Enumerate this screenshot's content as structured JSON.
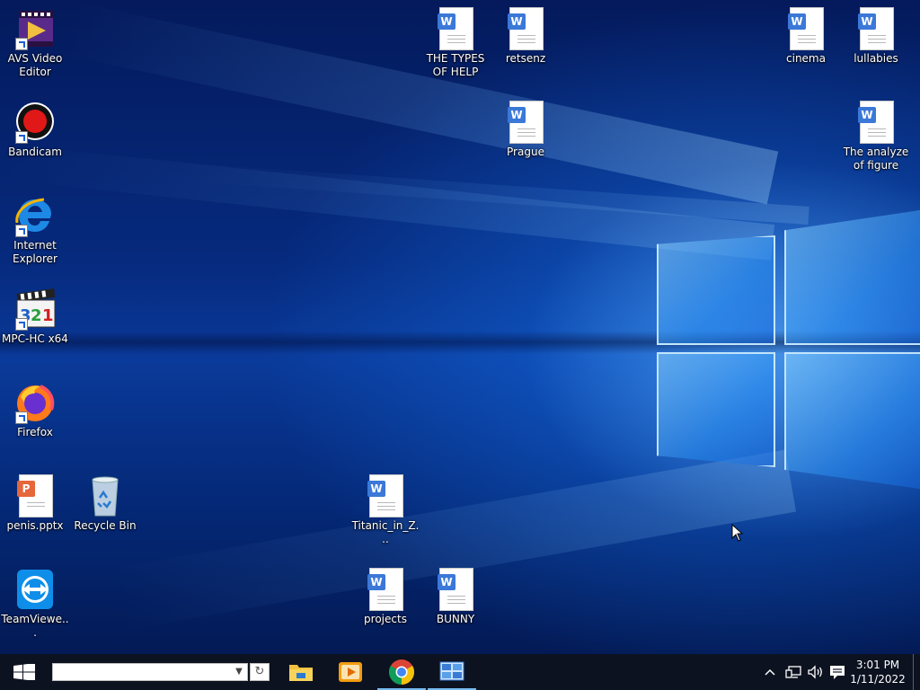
{
  "desktop": {
    "icons": [
      {
        "label": "AVS Video Editor",
        "icon": "avs-video-editor-icon",
        "shortcut": true
      },
      {
        "label": "Bandicam",
        "icon": "bandicam-icon",
        "shortcut": true
      },
      {
        "label": "Internet Explorer",
        "icon": "internet-explorer-icon",
        "shortcut": true
      },
      {
        "label": "MPC-HC x64",
        "icon": "mpc-hc-icon",
        "shortcut": true
      },
      {
        "label": "Firefox",
        "icon": "firefox-icon",
        "shortcut": true
      },
      {
        "label": "penis.pptx",
        "icon": "powerpoint-doc-icon",
        "shortcut": false
      },
      {
        "label": "Recycle Bin",
        "icon": "recycle-bin-icon",
        "shortcut": false
      },
      {
        "label": "TeamViewe...",
        "icon": "teamviewer-icon",
        "shortcut": false
      },
      {
        "label": "THE TYPES OF HELP",
        "icon": "word-doc-icon",
        "shortcut": false
      },
      {
        "label": "retsenz",
        "icon": "word-doc-icon",
        "shortcut": false
      },
      {
        "label": "Prague",
        "icon": "word-doc-icon",
        "shortcut": false
      },
      {
        "label": "cinema",
        "icon": "word-doc-icon",
        "shortcut": false
      },
      {
        "label": "lullabies",
        "icon": "word-doc-icon",
        "shortcut": false
      },
      {
        "label": "The analyze of figure",
        "icon": "word-doc-icon",
        "shortcut": false
      },
      {
        "label": "Titanic_in_Z...",
        "icon": "word-doc-icon",
        "shortcut": false
      },
      {
        "label": "projects",
        "icon": "word-doc-icon",
        "shortcut": false
      },
      {
        "label": "BUNNY",
        "icon": "word-doc-icon",
        "shortcut": false
      }
    ]
  },
  "taskbar": {
    "search": {
      "value": "",
      "placeholder": ""
    },
    "pinned": [
      {
        "icon": "file-explorer-icon",
        "active": false
      },
      {
        "icon": "media-player-icon",
        "active": false
      },
      {
        "icon": "chrome-icon",
        "active": true
      },
      {
        "icon": "control-panel-icon",
        "active": true
      }
    ],
    "tray": {
      "time": "3:01 PM",
      "date": "1/11/2022"
    }
  },
  "colors": {
    "taskbar_bg": "#0c1220",
    "accent_underline": "#76b9ed",
    "word_badge": "#3b78d8"
  }
}
